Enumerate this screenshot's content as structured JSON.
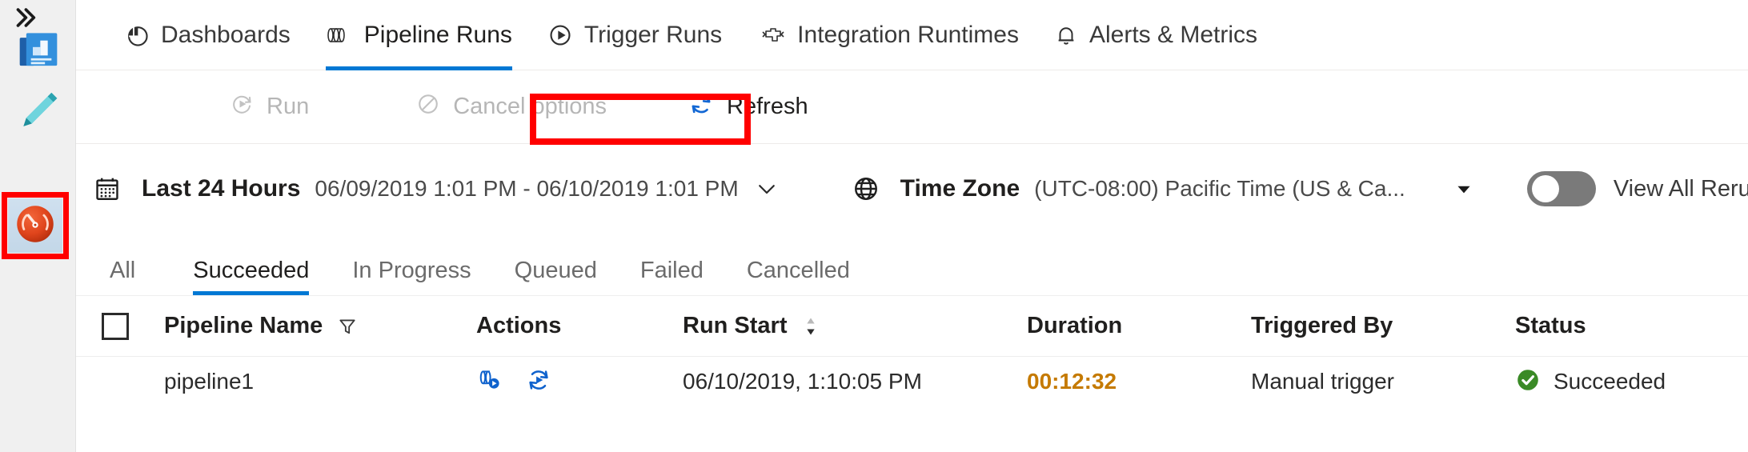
{
  "rail": {
    "expand_icon": "chevron-double-right-icon",
    "items": [
      {
        "name": "data-factory-overview",
        "icon": "factory-overview-icon",
        "selected": false
      },
      {
        "name": "author",
        "icon": "pencil-icon",
        "selected": false
      },
      {
        "name": "monitor",
        "icon": "gauge-icon",
        "selected": true
      }
    ]
  },
  "annotations": {
    "monitor_highlight": "red-box",
    "refresh_highlight": "red-box",
    "color": "#ff0000"
  },
  "nav": {
    "tabs": [
      {
        "label": "Dashboards",
        "icon": "pie-chart-icon",
        "active": false
      },
      {
        "label": "Pipeline Runs",
        "icon": "pipeline-icon",
        "active": true
      },
      {
        "label": "Trigger Runs",
        "icon": "play-circle-icon",
        "active": false
      },
      {
        "label": "Integration Runtimes",
        "icon": "integration-runtime-icon",
        "active": false
      },
      {
        "label": "Alerts & Metrics",
        "icon": "bell-icon",
        "active": false
      }
    ]
  },
  "commandbar": {
    "run": {
      "label": "Run",
      "icon": "run-icon",
      "enabled": false
    },
    "cancel": {
      "label": "Cancel options",
      "icon": "cancel-icon",
      "enabled": false
    },
    "refresh": {
      "label": "Refresh",
      "icon": "refresh-icon",
      "enabled": true
    }
  },
  "filters": {
    "date": {
      "icon": "calendar-icon",
      "label": "Last 24 Hours",
      "value": "06/09/2019 1:01 PM - 06/10/2019 1:01 PM",
      "chevron": "chevron-down-icon"
    },
    "timezone": {
      "icon": "globe-icon",
      "label": "Time Zone",
      "value": "(UTC-08:00) Pacific Time (US & Ca...",
      "caret": "caret-down-icon"
    },
    "view_all_reruns": {
      "label": "View All Reru",
      "state": "off",
      "track_color": "#7a7a7a"
    }
  },
  "status_pivots": [
    {
      "label": "All",
      "active": false
    },
    {
      "label": "Succeeded",
      "active": true
    },
    {
      "label": "In Progress",
      "active": false
    },
    {
      "label": "Queued",
      "active": false
    },
    {
      "label": "Failed",
      "active": false
    },
    {
      "label": "Cancelled",
      "active": false
    }
  ],
  "table": {
    "columns": {
      "select_all": {
        "name": "select-all-checkbox",
        "checked": false
      },
      "pipeline_name": {
        "label": "Pipeline Name",
        "icon": "filter-icon"
      },
      "actions": {
        "label": "Actions"
      },
      "run_start": {
        "label": "Run Start",
        "icon": "sort-descending-icon"
      },
      "duration": {
        "label": "Duration"
      },
      "triggered_by": {
        "label": "Triggered By"
      },
      "status": {
        "label": "Status"
      }
    },
    "rows": [
      {
        "pipeline_name": "pipeline1",
        "actions": [
          "view-activity-runs-icon",
          "rerun-icon"
        ],
        "run_start": "06/10/2019, 1:10:05 PM",
        "duration": "00:12:32",
        "triggered_by": "Manual trigger",
        "status": "Succeeded",
        "status_icon": "success-check-icon"
      }
    ]
  },
  "colors": {
    "accent": "#0078d4",
    "action_icon": "#0f62cd",
    "duration": "#c57a00",
    "success": "#3a8a26",
    "annotation": "#ff0000"
  }
}
